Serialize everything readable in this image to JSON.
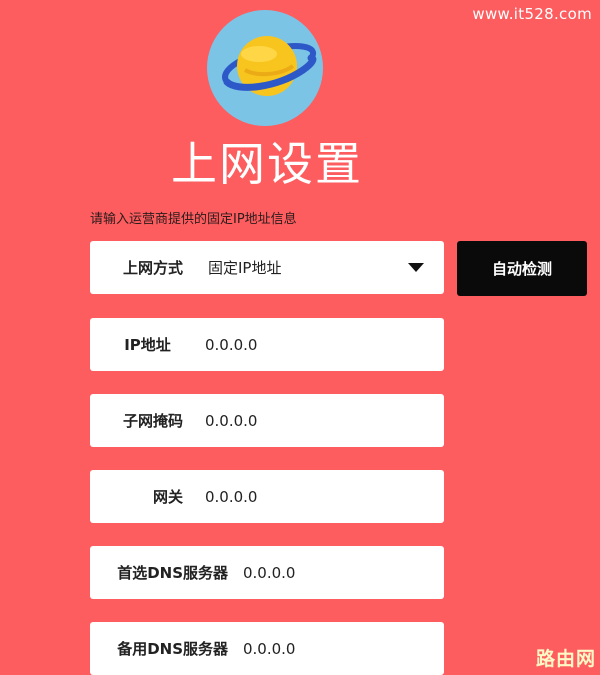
{
  "watermark": "www.it528.com",
  "page_title": "上网设置",
  "hint": "请输入运营商提供的固定IP地址信息",
  "connection": {
    "label": "上网方式",
    "value": "固定IP地址"
  },
  "detect_button": "自动检测",
  "fields": {
    "ip": {
      "label": "IP地址",
      "value": "0.0.0.0"
    },
    "mask": {
      "label": "子网掩码",
      "value": "0.0.0.0"
    },
    "gateway": {
      "label": "网关",
      "value": "0.0.0.0"
    },
    "dns1": {
      "label": "首选DNS服务器",
      "value": "0.0.0.0"
    },
    "dns2": {
      "label": "备用DNS服务器",
      "value": "0.0.0.0"
    }
  },
  "corner_mark": "路由网",
  "logo_icon": "planet-icon",
  "colors": {
    "background": "#fd5d5f",
    "button": "#0a0a0a",
    "logo_circle": "#7cc4e6",
    "planet": "#f7c51e",
    "ring": "#2d59c8"
  }
}
